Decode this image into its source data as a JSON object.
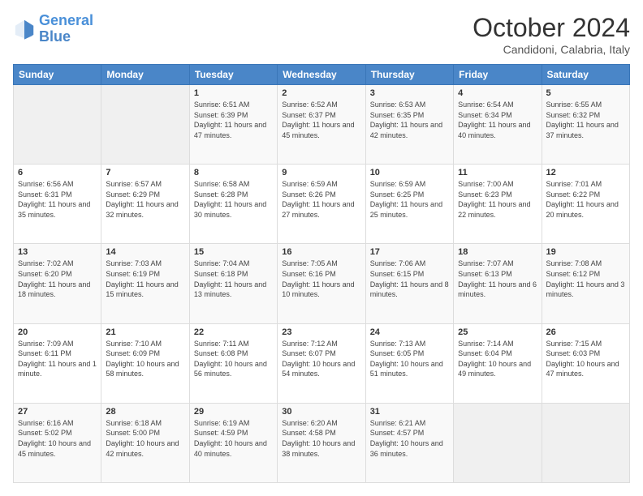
{
  "header": {
    "logo": {
      "line1": "General",
      "line2": "Blue"
    },
    "title": "October 2024",
    "location": "Candidoni, Calabria, Italy"
  },
  "days_of_week": [
    "Sunday",
    "Monday",
    "Tuesday",
    "Wednesday",
    "Thursday",
    "Friday",
    "Saturday"
  ],
  "weeks": [
    [
      {
        "day": null
      },
      {
        "day": null
      },
      {
        "day": "1",
        "sunrise": "Sunrise: 6:51 AM",
        "sunset": "Sunset: 6:39 PM",
        "daylight": "Daylight: 11 hours and 47 minutes."
      },
      {
        "day": "2",
        "sunrise": "Sunrise: 6:52 AM",
        "sunset": "Sunset: 6:37 PM",
        "daylight": "Daylight: 11 hours and 45 minutes."
      },
      {
        "day": "3",
        "sunrise": "Sunrise: 6:53 AM",
        "sunset": "Sunset: 6:35 PM",
        "daylight": "Daylight: 11 hours and 42 minutes."
      },
      {
        "day": "4",
        "sunrise": "Sunrise: 6:54 AM",
        "sunset": "Sunset: 6:34 PM",
        "daylight": "Daylight: 11 hours and 40 minutes."
      },
      {
        "day": "5",
        "sunrise": "Sunrise: 6:55 AM",
        "sunset": "Sunset: 6:32 PM",
        "daylight": "Daylight: 11 hours and 37 minutes."
      }
    ],
    [
      {
        "day": "6",
        "sunrise": "Sunrise: 6:56 AM",
        "sunset": "Sunset: 6:31 PM",
        "daylight": "Daylight: 11 hours and 35 minutes."
      },
      {
        "day": "7",
        "sunrise": "Sunrise: 6:57 AM",
        "sunset": "Sunset: 6:29 PM",
        "daylight": "Daylight: 11 hours and 32 minutes."
      },
      {
        "day": "8",
        "sunrise": "Sunrise: 6:58 AM",
        "sunset": "Sunset: 6:28 PM",
        "daylight": "Daylight: 11 hours and 30 minutes."
      },
      {
        "day": "9",
        "sunrise": "Sunrise: 6:59 AM",
        "sunset": "Sunset: 6:26 PM",
        "daylight": "Daylight: 11 hours and 27 minutes."
      },
      {
        "day": "10",
        "sunrise": "Sunrise: 6:59 AM",
        "sunset": "Sunset: 6:25 PM",
        "daylight": "Daylight: 11 hours and 25 minutes."
      },
      {
        "day": "11",
        "sunrise": "Sunrise: 7:00 AM",
        "sunset": "Sunset: 6:23 PM",
        "daylight": "Daylight: 11 hours and 22 minutes."
      },
      {
        "day": "12",
        "sunrise": "Sunrise: 7:01 AM",
        "sunset": "Sunset: 6:22 PM",
        "daylight": "Daylight: 11 hours and 20 minutes."
      }
    ],
    [
      {
        "day": "13",
        "sunrise": "Sunrise: 7:02 AM",
        "sunset": "Sunset: 6:20 PM",
        "daylight": "Daylight: 11 hours and 18 minutes."
      },
      {
        "day": "14",
        "sunrise": "Sunrise: 7:03 AM",
        "sunset": "Sunset: 6:19 PM",
        "daylight": "Daylight: 11 hours and 15 minutes."
      },
      {
        "day": "15",
        "sunrise": "Sunrise: 7:04 AM",
        "sunset": "Sunset: 6:18 PM",
        "daylight": "Daylight: 11 hours and 13 minutes."
      },
      {
        "day": "16",
        "sunrise": "Sunrise: 7:05 AM",
        "sunset": "Sunset: 6:16 PM",
        "daylight": "Daylight: 11 hours and 10 minutes."
      },
      {
        "day": "17",
        "sunrise": "Sunrise: 7:06 AM",
        "sunset": "Sunset: 6:15 PM",
        "daylight": "Daylight: 11 hours and 8 minutes."
      },
      {
        "day": "18",
        "sunrise": "Sunrise: 7:07 AM",
        "sunset": "Sunset: 6:13 PM",
        "daylight": "Daylight: 11 hours and 6 minutes."
      },
      {
        "day": "19",
        "sunrise": "Sunrise: 7:08 AM",
        "sunset": "Sunset: 6:12 PM",
        "daylight": "Daylight: 11 hours and 3 minutes."
      }
    ],
    [
      {
        "day": "20",
        "sunrise": "Sunrise: 7:09 AM",
        "sunset": "Sunset: 6:11 PM",
        "daylight": "Daylight: 11 hours and 1 minute."
      },
      {
        "day": "21",
        "sunrise": "Sunrise: 7:10 AM",
        "sunset": "Sunset: 6:09 PM",
        "daylight": "Daylight: 10 hours and 58 minutes."
      },
      {
        "day": "22",
        "sunrise": "Sunrise: 7:11 AM",
        "sunset": "Sunset: 6:08 PM",
        "daylight": "Daylight: 10 hours and 56 minutes."
      },
      {
        "day": "23",
        "sunrise": "Sunrise: 7:12 AM",
        "sunset": "Sunset: 6:07 PM",
        "daylight": "Daylight: 10 hours and 54 minutes."
      },
      {
        "day": "24",
        "sunrise": "Sunrise: 7:13 AM",
        "sunset": "Sunset: 6:05 PM",
        "daylight": "Daylight: 10 hours and 51 minutes."
      },
      {
        "day": "25",
        "sunrise": "Sunrise: 7:14 AM",
        "sunset": "Sunset: 6:04 PM",
        "daylight": "Daylight: 10 hours and 49 minutes."
      },
      {
        "day": "26",
        "sunrise": "Sunrise: 7:15 AM",
        "sunset": "Sunset: 6:03 PM",
        "daylight": "Daylight: 10 hours and 47 minutes."
      }
    ],
    [
      {
        "day": "27",
        "sunrise": "Sunrise: 6:16 AM",
        "sunset": "Sunset: 5:02 PM",
        "daylight": "Daylight: 10 hours and 45 minutes."
      },
      {
        "day": "28",
        "sunrise": "Sunrise: 6:18 AM",
        "sunset": "Sunset: 5:00 PM",
        "daylight": "Daylight: 10 hours and 42 minutes."
      },
      {
        "day": "29",
        "sunrise": "Sunrise: 6:19 AM",
        "sunset": "Sunset: 4:59 PM",
        "daylight": "Daylight: 10 hours and 40 minutes."
      },
      {
        "day": "30",
        "sunrise": "Sunrise: 6:20 AM",
        "sunset": "Sunset: 4:58 PM",
        "daylight": "Daylight: 10 hours and 38 minutes."
      },
      {
        "day": "31",
        "sunrise": "Sunrise: 6:21 AM",
        "sunset": "Sunset: 4:57 PM",
        "daylight": "Daylight: 10 hours and 36 minutes."
      },
      {
        "day": null
      },
      {
        "day": null
      }
    ]
  ]
}
